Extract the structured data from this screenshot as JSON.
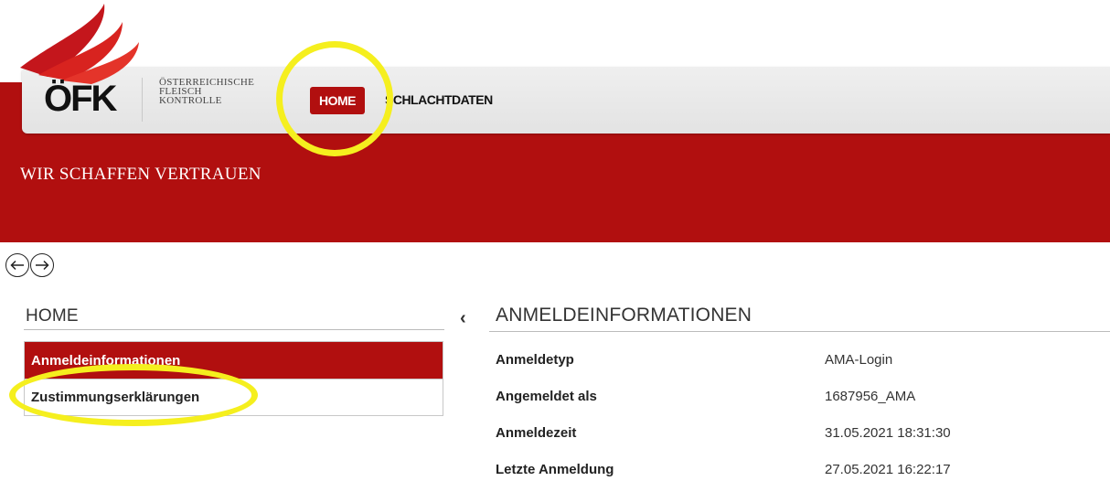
{
  "header": {
    "logo_text": "ÖFK",
    "logo_subtitle": [
      "ÖSTERREICHISCHE",
      "FLEISCH",
      "KONTROLLE"
    ],
    "slogan": "WIR SCHAFFEN VERTRAUEN",
    "accent_color": "#b10f0f"
  },
  "nav": {
    "items": [
      {
        "label": "HOME",
        "active": true
      },
      {
        "label": "SCHLACHTDATEN",
        "active": false
      }
    ]
  },
  "history": {
    "back_icon": "arrow-left-circle-icon",
    "forward_icon": "arrow-right-circle-icon"
  },
  "sidebar": {
    "title": "HOME",
    "items": [
      {
        "label": "Anmeldeinformationen",
        "active": true
      },
      {
        "label": "Zustimmungserklärungen",
        "active": false
      }
    ],
    "collapse_icon": "chevron-left-icon"
  },
  "main": {
    "title": "ANMELDEINFORMATIONEN",
    "rows": [
      {
        "label": "Anmeldetyp",
        "value": "AMA-Login"
      },
      {
        "label": "Angemeldet als",
        "value": "1687956_AMA"
      },
      {
        "label": "Anmeldezeit",
        "value": "31.05.2021 18:31:30"
      },
      {
        "label": "Letzte Anmeldung",
        "value": "27.05.2021 16:22:17"
      }
    ]
  },
  "annotations": {
    "highlight_color": "#f5ef1e"
  }
}
